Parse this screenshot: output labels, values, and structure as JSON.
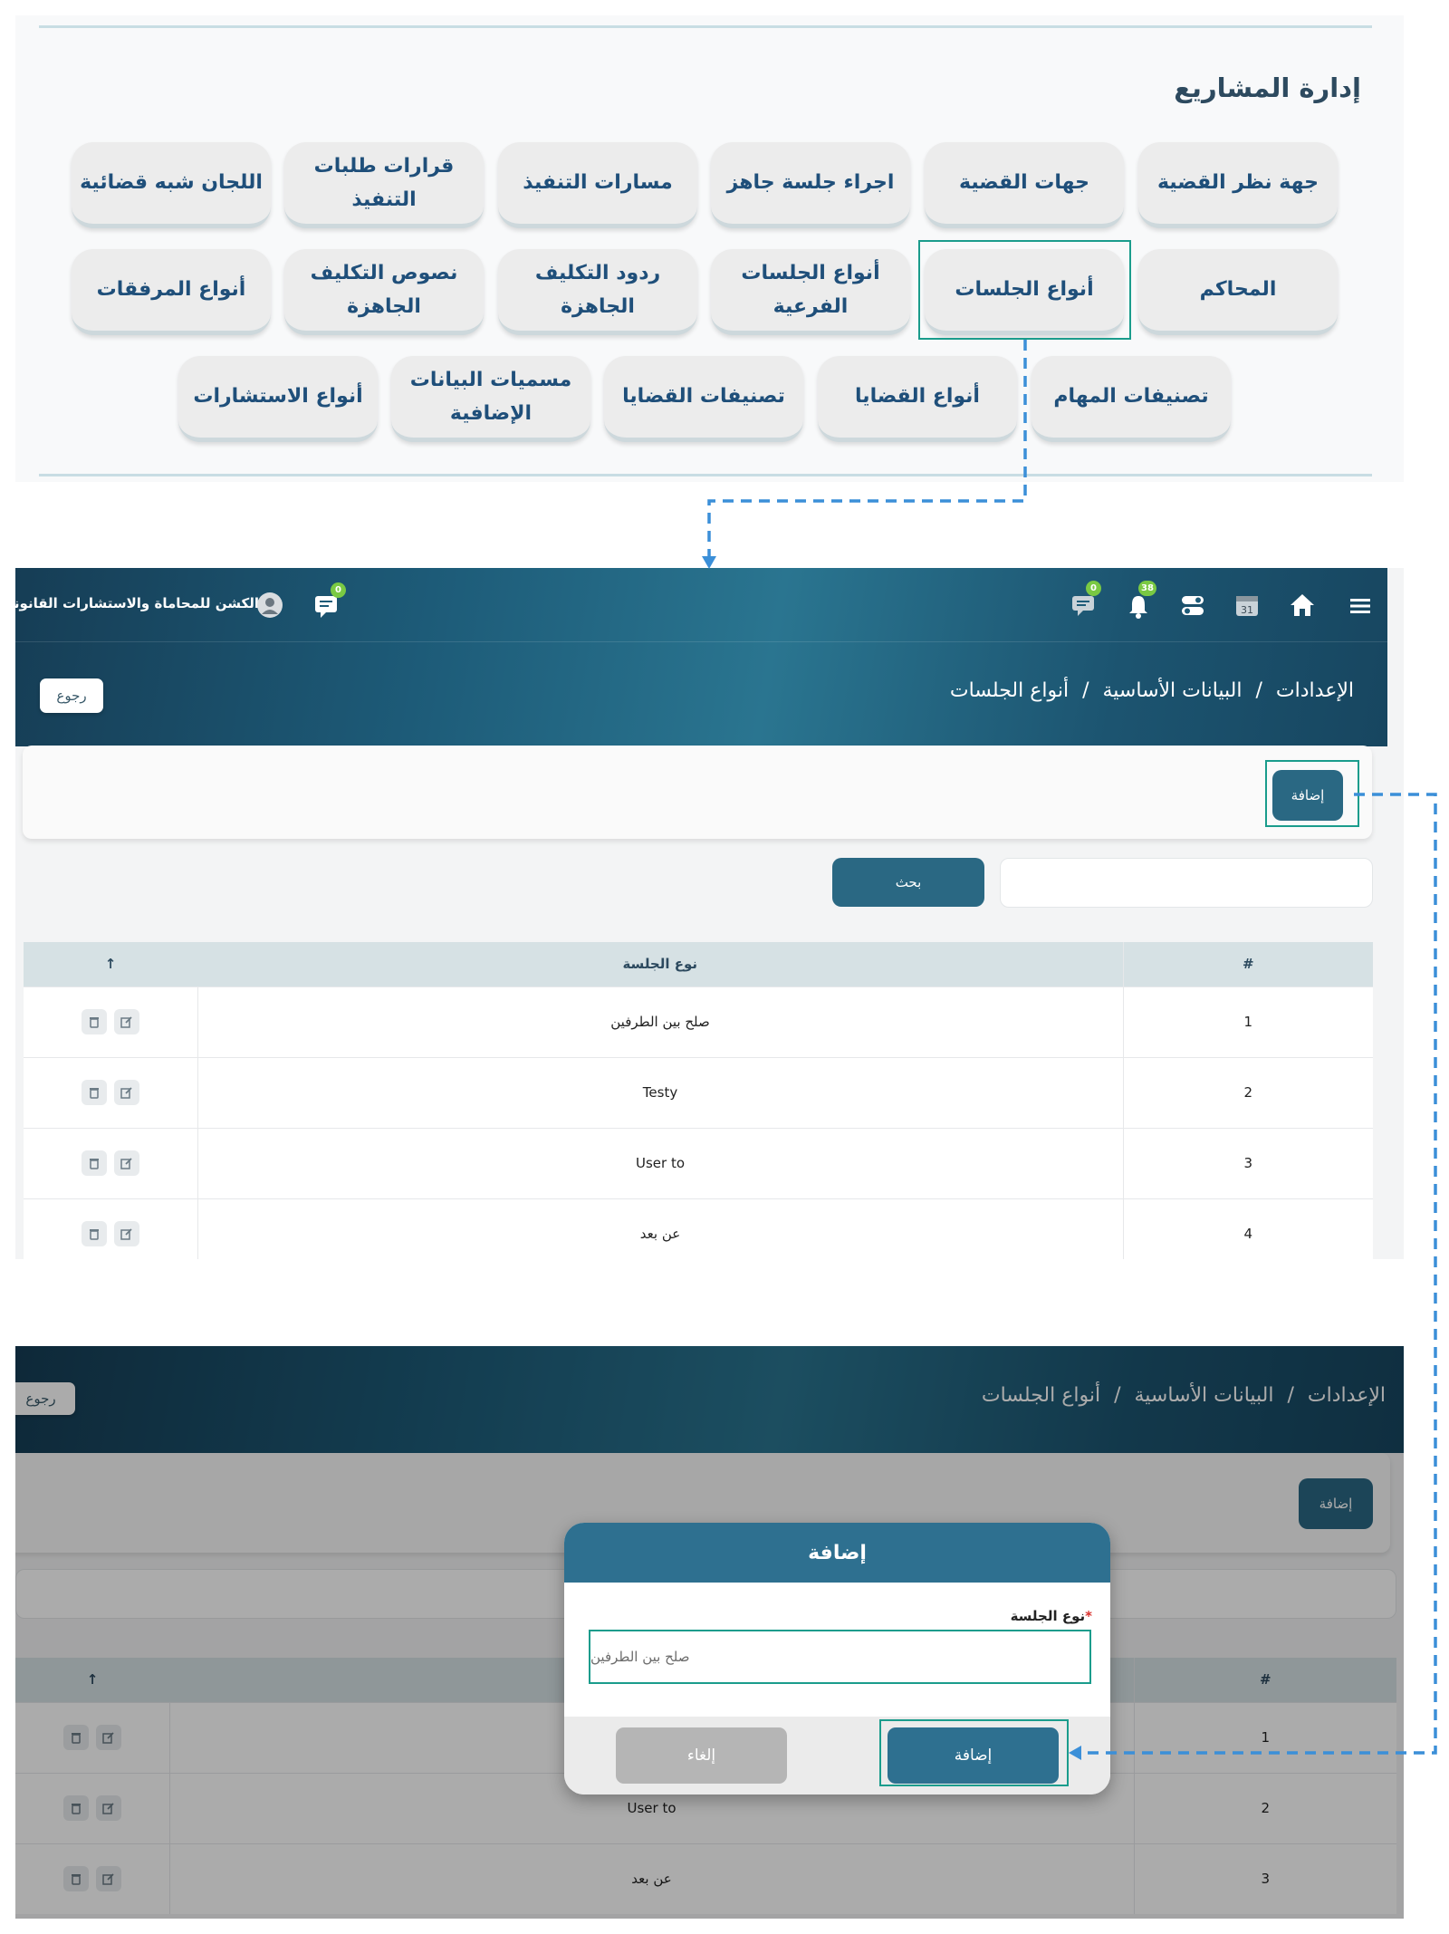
{
  "projects": {
    "title": "إدارة المشاريع",
    "row1": [
      "جهة نظر القضية",
      "جهات القضية",
      "اجراء جلسة جاهز",
      "مسارات التنفيذ",
      "قرارات طلبات التنفيذ",
      "اللجان شبه قضائية"
    ],
    "row2": [
      "المحاكم",
      "أنواع الجلسات",
      "أنواع الجلسات الفرعية",
      "ردود التكليف الجاهزة",
      "نصوص التكليف الجاهزة",
      "أنواع المرفقات"
    ],
    "row3": [
      "تصنيفات المهام",
      "أنواع القضايا",
      "تصنيفات القضايا",
      "مسميات البيانات الإضافية",
      "أنواع الاستشارات"
    ]
  },
  "list_page": {
    "brand": "الكشن للمحاماة والاستشارات القانونية",
    "badges": {
      "messages": "0",
      "chat": "0",
      "notifications": "38"
    },
    "calendar_day": "31",
    "breadcrumb": [
      "الإعدادات",
      "البيانات الأساسية",
      "أنواع الجلسات"
    ],
    "back_label": "رجوع",
    "add_label": "إضافة",
    "search_label": "بحث",
    "table": {
      "headers": {
        "num": "#",
        "type": "نوع الجلسة",
        "sort": "↑"
      },
      "rows": [
        {
          "num": "1",
          "type": "صلح بين الطرفين"
        },
        {
          "num": "2",
          "type": "Testy"
        },
        {
          "num": "3",
          "type": "User to"
        },
        {
          "num": "4",
          "type": "عن بعد"
        }
      ]
    }
  },
  "modal_page": {
    "breadcrumb": [
      "الإعدادات",
      "البيانات الأساسية",
      "أنواع الجلسات"
    ],
    "back_label": "رجوع",
    "add_label": "إضافة",
    "table": {
      "headers": {
        "num": "#",
        "sort": "↑"
      },
      "rows": [
        {
          "num": "1",
          "type": ""
        },
        {
          "num": "2",
          "type": "User to"
        },
        {
          "num": "3",
          "type": "عن بعد"
        }
      ]
    },
    "modal": {
      "title": "إضافة",
      "field_label": "نوع الجلسة",
      "required_mark": "*",
      "field_value": "صلح بين الطرفين",
      "save_label": "إضافة",
      "cancel_label": "إلغاء"
    }
  },
  "colors": {
    "primary": "#2e7090",
    "highlight": "#1a9c8c",
    "connector": "#3b8fd8",
    "badge": "#7ac943"
  }
}
